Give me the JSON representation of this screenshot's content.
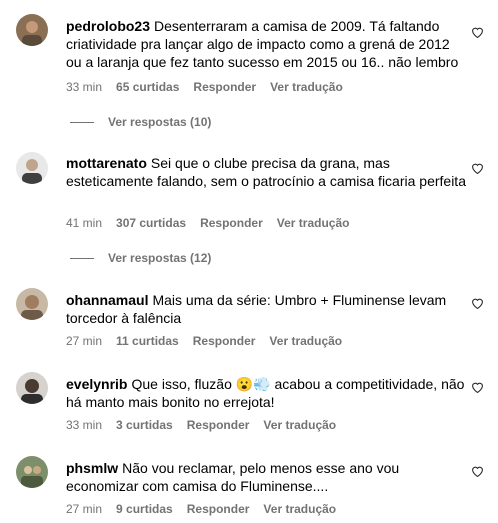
{
  "comments": [
    {
      "username": "pedrolobo23",
      "text": "Desenterraram a camisa de 2009. Tá faltando criatividade pra lançar algo de impacto como a grená de 2012 ou a laranja que fez tanto sucesso em 2015 ou 16.. não lembro",
      "time": "33 min",
      "likes": "65 curtidas",
      "reply_label": "Responder",
      "translate_label": "Ver tradução",
      "view_replies": "Ver respostas (10)"
    },
    {
      "username": "mottarenato",
      "text": "Sei que o clube precisa da grana, mas esteticamente falando, sem o patrocínio a camisa ficaria perfeita",
      "time": "41 min",
      "likes": "307 curtidas",
      "reply_label": "Responder",
      "translate_label": "Ver tradução",
      "view_replies": "Ver respostas (12)"
    },
    {
      "username": "ohannamaul",
      "text": "Mais uma da série: Umbro + Fluminense levam torcedor à falência",
      "time": "27 min",
      "likes": "11 curtidas",
      "reply_label": "Responder",
      "translate_label": "Ver tradução"
    },
    {
      "username": "evelynrib",
      "text": "Que isso, fluzão 😮💨 acabou a competitividade, não há manto mais bonito no errejota!",
      "time": "33 min",
      "likes": "3 curtidas",
      "reply_label": "Responder",
      "translate_label": "Ver tradução"
    },
    {
      "username": "phsmlw",
      "text": "Não vou reclamar, pelo menos esse ano vou economizar com camisa do Fluminense....",
      "time": "27 min",
      "likes": "9 curtidas",
      "reply_label": "Responder",
      "translate_label": "Ver tradução"
    }
  ],
  "icons": {
    "like": "heart-outline-icon"
  },
  "colors": {
    "meta_text": "#737373",
    "text": "#000000",
    "background": "#ffffff"
  }
}
